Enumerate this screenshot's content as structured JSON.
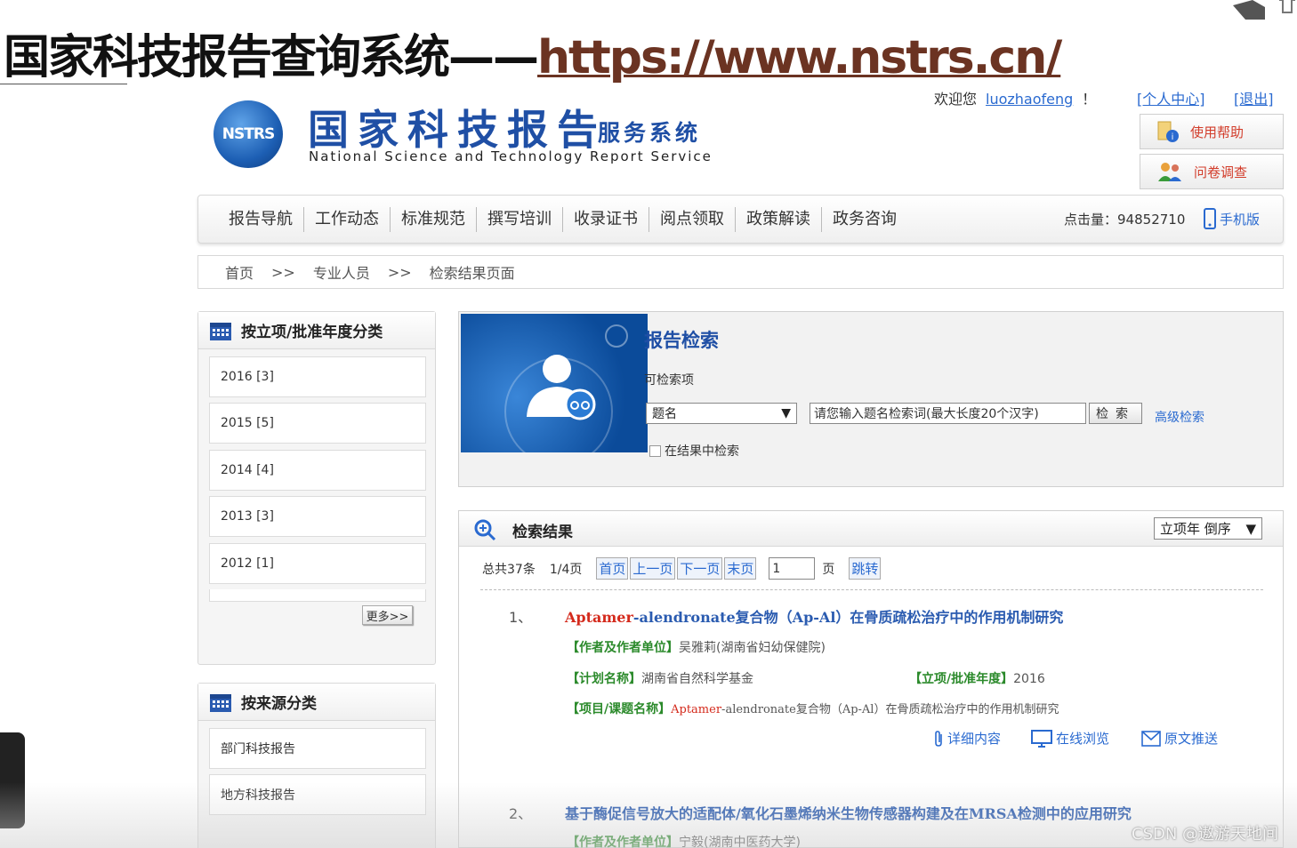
{
  "slide": {
    "title_prefix": "国家科技报告查询系统——",
    "title_url": "https://www.nstrs.cn/",
    "watermark": "CSDN @遨游天地间"
  },
  "header": {
    "logo_text": "NSTRS",
    "name_cn": "国家科技报告",
    "name_cn_sub": "服务系统",
    "name_en": "National Science and Technology Report Service",
    "welcome": "欢迎您",
    "username": "luozhaofeng",
    "exclaim": "！",
    "personal_center": "[个人中心]",
    "logout": "[退出]",
    "help_btn": "使用帮助",
    "survey_btn": "问卷调查"
  },
  "nav": {
    "items": [
      "报告导航",
      "工作动态",
      "标准规范",
      "撰写培训",
      "收录证书",
      "阅点领取",
      "政策解读",
      "政务咨询"
    ],
    "hits_label": "点击量：",
    "hits_value": "94852710",
    "mobile": "手机版"
  },
  "breadcrumb": {
    "home": "首页",
    "sep": ">>",
    "level2": "专业人员",
    "current": "检索结果页面"
  },
  "year_panel": {
    "title": "按立项/批准年度分类",
    "items": [
      "2016 [3]",
      "2015 [5]",
      "2014 [4]",
      "2013 [3]",
      "2012 [1]"
    ],
    "more": "更多>>"
  },
  "source_panel": {
    "title": "按来源分类",
    "items": [
      "部门科技报告",
      "地方科技报告"
    ]
  },
  "search": {
    "title": "报告检索",
    "field_label": "可检索项",
    "field_value": "题名",
    "input_value": "请您输入题名检索词(最大长度20个汉字)",
    "button": "检索",
    "advanced": "高级检索",
    "in_results": "在结果中检索"
  },
  "results": {
    "title": "检索结果",
    "sort": "立项年 倒序",
    "total": "总共37条",
    "pages": "1/4页",
    "first": "首页",
    "prev": "上一页",
    "next": "下一页",
    "last": "末页",
    "page_input": "1",
    "page_unit": "页",
    "jump": "跳转",
    "items": [
      {
        "no": "1、",
        "title_red": "Aptamer",
        "title_rest": "-alendronate复合物（Ap-Al）在骨质疏松治疗中的作用机制研究",
        "author_label": "【作者及作者单位】",
        "author": "吴雅莉(湖南省妇幼保健院)",
        "plan_label": "【计划名称】",
        "plan": "湖南省自然科学基金",
        "year_label": "【立项/批准年度】",
        "year": "2016",
        "project_label": "【项目/课题名称】",
        "project_red": "Aptamer",
        "project_rest": "-alendronate复合物（Ap-Al）在骨质疏松治疗中的作用机制研究",
        "detail": "详细内容",
        "online": "在线浏览",
        "push": "原文推送"
      },
      {
        "no": "2、",
        "title_rest": "基于酶促信号放大的适配体/氧化石墨烯纳米生物传感器构建及在MRSA检测中的应用研究",
        "author_label": "【作者及作者单位】",
        "author": "宁毅(湖南中医药大学)"
      }
    ]
  },
  "colors": {
    "brand_blue": "#1f4fa5",
    "link_blue": "#2a6ad0",
    "highlight_red": "#d42a1c",
    "label_green": "#2b8a2b"
  }
}
